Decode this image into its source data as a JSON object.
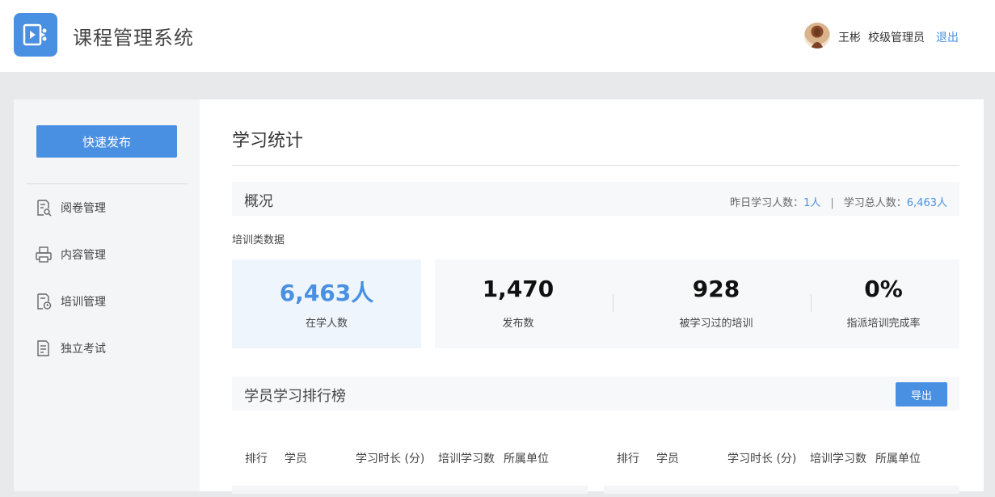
{
  "header": {
    "app_title": "课程管理系统",
    "user_name": "王彬",
    "user_role": "校级管理员",
    "logout": "退出",
    "logo_icon": "video-play-icon",
    "avatar_icon": "user-avatar"
  },
  "sidebar": {
    "quick_publish": "快速发布",
    "items": [
      {
        "label": "阅卷管理",
        "icon": "doc-search-icon"
      },
      {
        "label": "内容管理",
        "icon": "printer-icon"
      },
      {
        "label": "培训管理",
        "icon": "doc-clock-icon"
      },
      {
        "label": "独立考试",
        "icon": "doc-edit-icon"
      }
    ]
  },
  "main": {
    "page_title": "学习统计",
    "overview": {
      "title": "概况",
      "yesterday_label": "昨日学习人数：",
      "yesterday_value": "1人",
      "separator": "|",
      "total_label": "学习总人数：",
      "total_value": "6,463人"
    },
    "training_label": "培训类数据",
    "stats": [
      {
        "value": "6,463人",
        "caption": "在学人数"
      },
      {
        "value": "1,470",
        "caption": "发布数"
      },
      {
        "value": "928",
        "caption": "被学习过的培训"
      },
      {
        "value": "0%",
        "caption": "指派培训完成率"
      }
    ],
    "ranking": {
      "title": "学员学习排行榜",
      "export": "导出",
      "columns": [
        "排行",
        "学员",
        "学习时长 (分)",
        "培训学习数",
        "所属单位"
      ]
    }
  },
  "colors": {
    "accent": "#4a90e2",
    "page_bg": "#e8e9eb",
    "panel_bg": "#f7f8fa",
    "highlight_bg": "#eef5fc"
  }
}
